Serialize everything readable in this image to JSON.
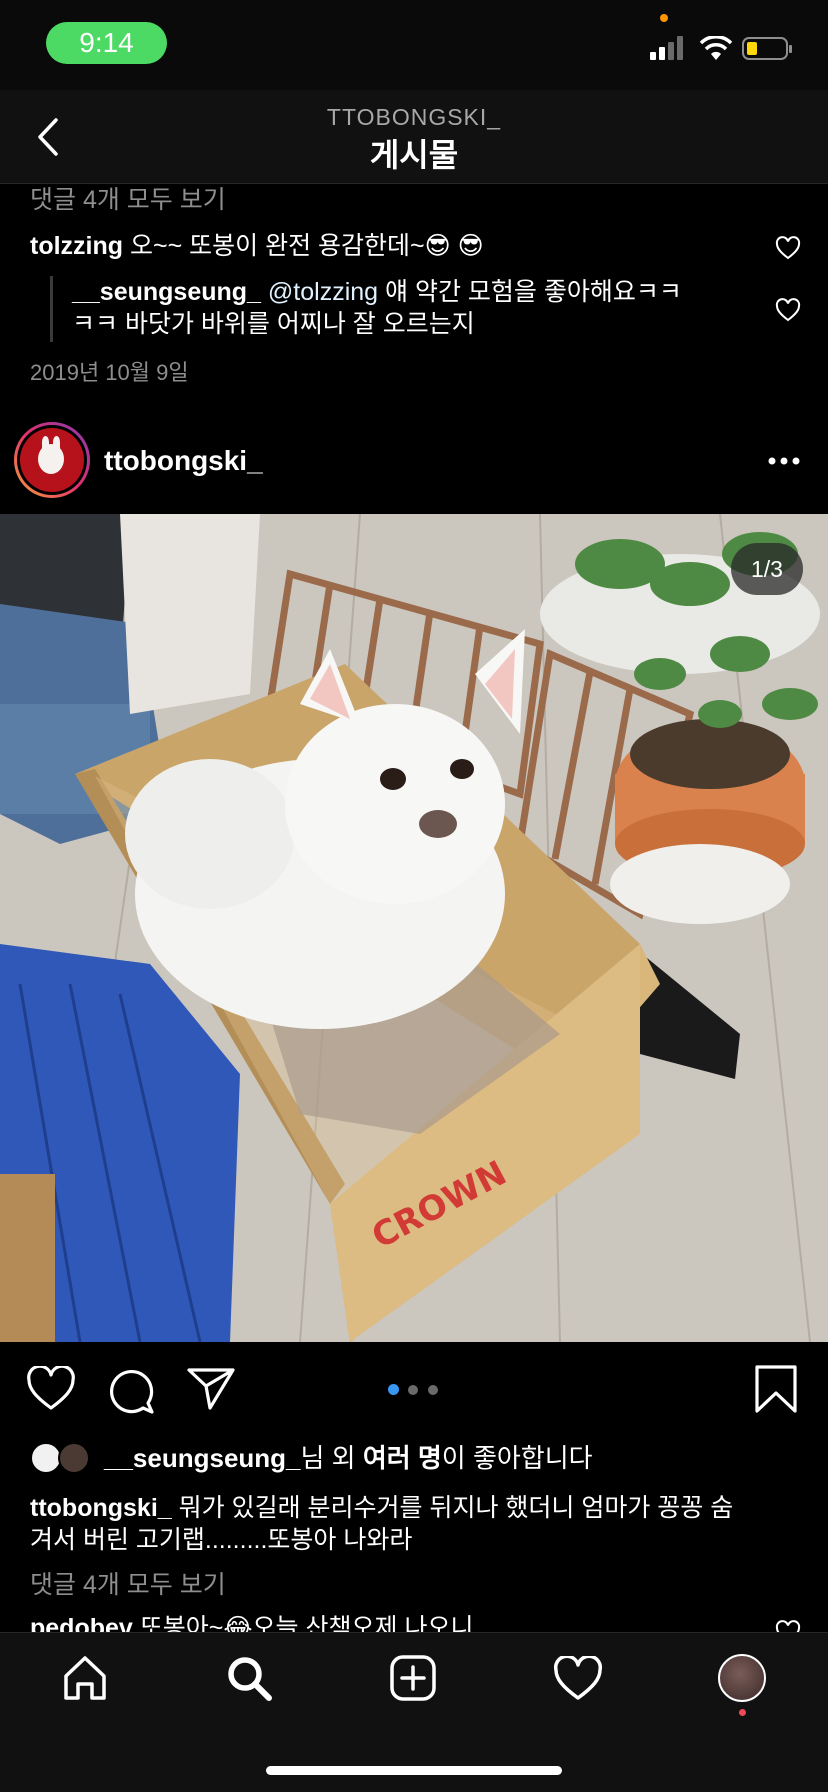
{
  "status": {
    "time": "9:14"
  },
  "header": {
    "account": "TTOBONGSKI_",
    "title": "게시물"
  },
  "prev_post": {
    "view_all_comments": "댓글 4개 모두 보기",
    "comment1": {
      "user": "tolzzing",
      "text": "오~~ 또봉이 완전 용감한데~😎 😎"
    },
    "reply": {
      "user": "__seungseung_",
      "mention": "@tolzzing",
      "line1": "얘 약간 모험을 좋아해요ㅋㅋ",
      "line2": "ㅋㅋ 바닷가 바위를 어찌나 잘 오르는지"
    },
    "date": "2019년 10월 9일"
  },
  "post": {
    "username": "ttobongski_",
    "image_counter": "1/3",
    "carousel": {
      "count": 3,
      "active": 0
    },
    "likes": {
      "user": "__seungseung_",
      "mid": "님 외 ",
      "bold": "여러 명",
      "end": "이 좋아합니다"
    },
    "caption": {
      "user": "ttobongski_",
      "line1": "뭐가 있길래 분리수거를 뒤지나 했더니 엄마가 꽁꽁 숨",
      "line2": "겨서 버린 고기랩.........또봉아 나와라"
    },
    "view_all_comments": "댓글 4개 모두 보기",
    "peek_comment": {
      "user": "pedobev",
      "text": "또봉아~😂오늘 산책오제 나오니"
    }
  },
  "colors": {
    "accent_blue": "#3897f0",
    "status_green": "#4cd964",
    "notif_red": "#ed4956"
  },
  "icons": {
    "tabbar": [
      "home-icon",
      "search-icon",
      "add-post-icon",
      "activity-heart-icon",
      "profile-avatar"
    ],
    "actions": [
      "like-heart-icon",
      "comment-bubble-icon",
      "share-send-icon",
      "bookmark-icon"
    ]
  }
}
